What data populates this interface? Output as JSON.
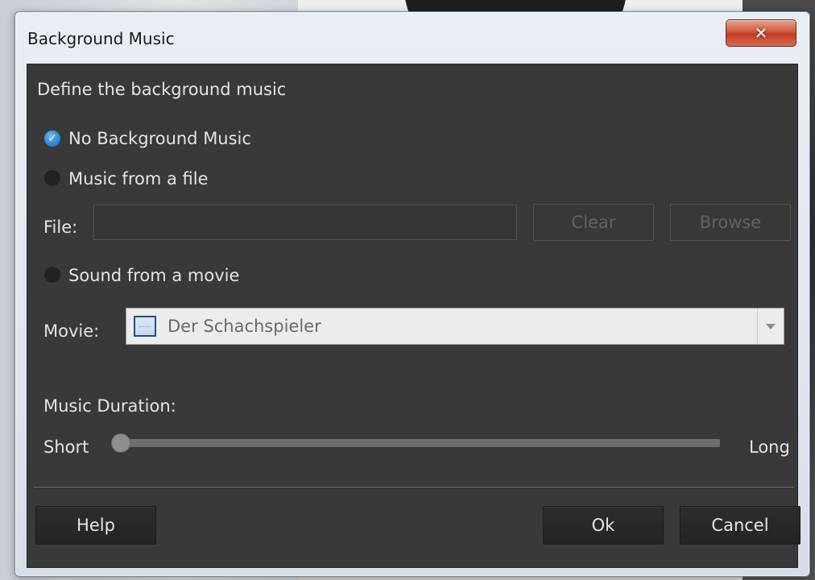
{
  "window": {
    "title": "Background Music"
  },
  "description": "Define the background music",
  "options": {
    "no_music": "No Background Music",
    "music_file": "Music from a file",
    "movie_sound": "Sound from a movie",
    "selected": "no_music"
  },
  "file": {
    "label": "File:",
    "value": "",
    "clear_label": "Clear",
    "browse_label": "Browse"
  },
  "movie": {
    "label": "Movie:",
    "selected": "Der Schachspieler"
  },
  "duration": {
    "label": "Music Duration:",
    "min_label": "Short",
    "max_label": "Long",
    "value": 0
  },
  "buttons": {
    "help": "Help",
    "ok": "Ok",
    "cancel": "Cancel"
  },
  "colors": {
    "panel_bg": "#393939",
    "radio_checked": "#2a86d9",
    "close_button": "#c8452a"
  }
}
